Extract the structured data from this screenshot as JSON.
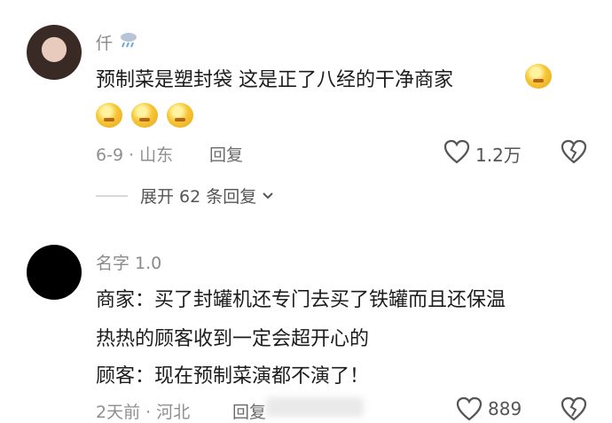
{
  "comment1": {
    "username": "仟",
    "text": "预制菜是塑封袋  这是正了八经的干净商家",
    "meta": "6-9 · 山东",
    "reply": "回复",
    "likes": "1.2万",
    "expand": "展开 62 条回复"
  },
  "comment2": {
    "username": "名字 1.0",
    "line1": "商家：买了封罐机还专门去买了铁罐而且还保温",
    "line2": "热热的顾客收到一定会超开心的",
    "line3": "顾客：现在预制菜演都不演了！",
    "meta": "2天前 · 河北",
    "reply": "回复",
    "likes": "889"
  }
}
